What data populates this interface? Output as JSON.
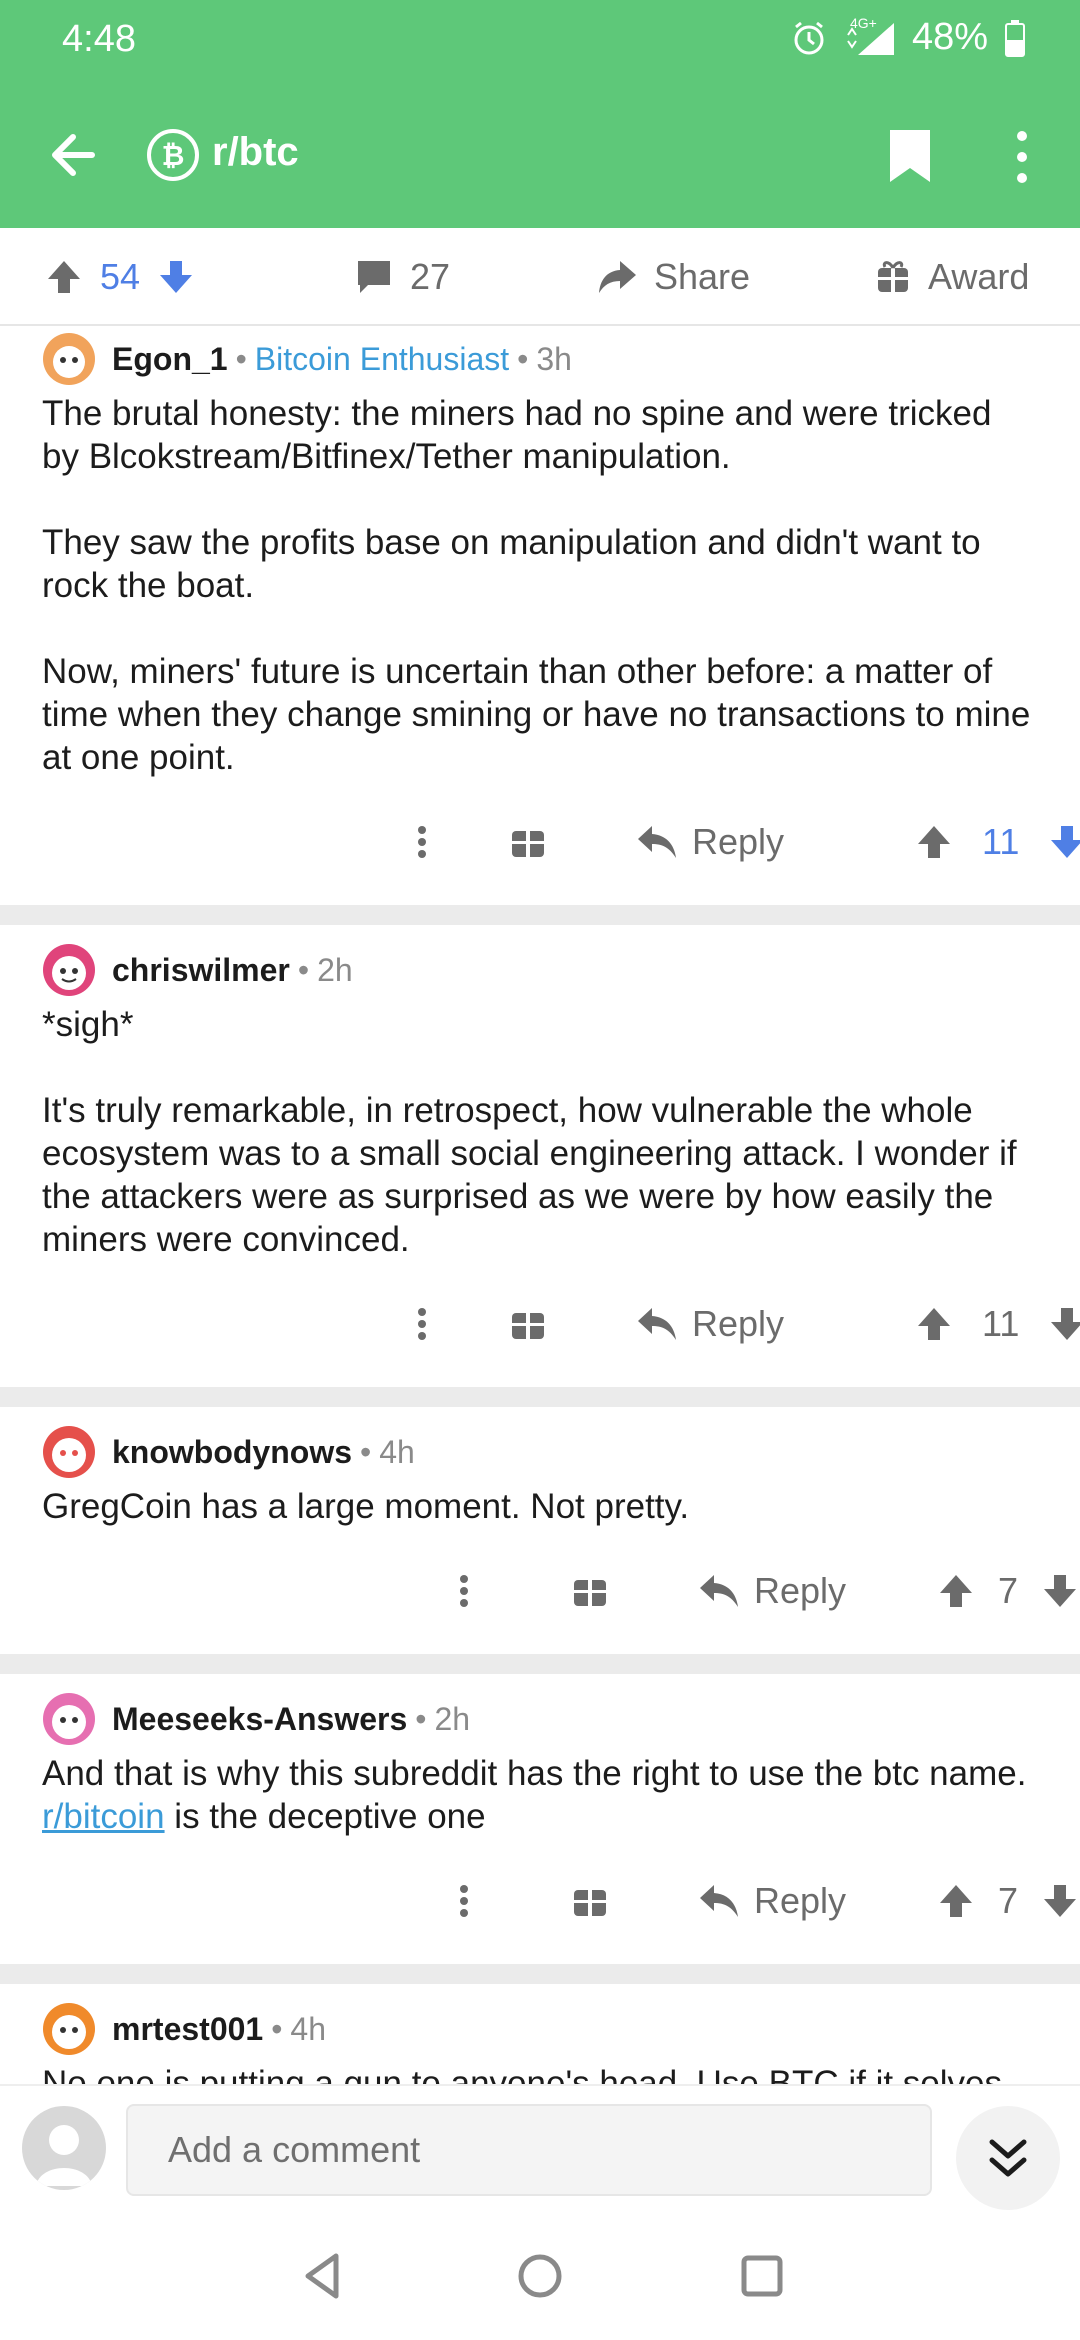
{
  "status": {
    "time": "4:48",
    "network": "4G+",
    "battery": "48%"
  },
  "header": {
    "subreddit": "r/btc"
  },
  "post_bar": {
    "score": "54",
    "comments": "27",
    "share": "Share",
    "award": "Award"
  },
  "comments": [
    {
      "author": "Egon_1",
      "flair": "Bitcoin Enthusiast",
      "age": "3h",
      "paragraphs": [
        "The brutal honesty: the miners had no spine and were tricked by Blcokstream/Bitfinex/Tether manipulation.",
        "They saw the profits base on manipulation and didn't want to rock the boat.",
        "Now,  miners' future is uncertain than other before: a matter of time when they change smining or have no transactions to mine at one point."
      ],
      "reply": "Reply",
      "score": "11"
    },
    {
      "author": "chriswilmer",
      "age": "2h",
      "paragraphs": [
        "*sigh*",
        "It's truly remarkable, in retrospect, how vulnerable the whole ecosystem was to a small social engineering attack. I wonder if the attackers were as surprised as we were by how easily the miners were convinced."
      ],
      "reply": "Reply",
      "score": "11"
    },
    {
      "author": "knowbodynows",
      "age": "4h",
      "paragraphs": [
        "GregCoin has a large moment. Not pretty."
      ],
      "reply": "Reply",
      "score": "7"
    },
    {
      "author": "Meeseeks-Answers",
      "age": "2h",
      "text_before_link": "And that is why this subreddit has the right to use the btc name. ",
      "link_text": "r/bitcoin",
      "text_after_link": " is the deceptive one",
      "reply": "Reply",
      "score": "7"
    },
    {
      "author": "mrtest001",
      "age": "4h",
      "paragraphs": [
        "No one is putting a gun to anyone's head. Use BTC if it solves"
      ]
    }
  ],
  "compose": {
    "placeholder": "Add a comment"
  },
  "colors": {
    "header_green": "#5ec879",
    "upvote_blue": "#4f7fe5",
    "link_blue": "#3b9bd8"
  }
}
